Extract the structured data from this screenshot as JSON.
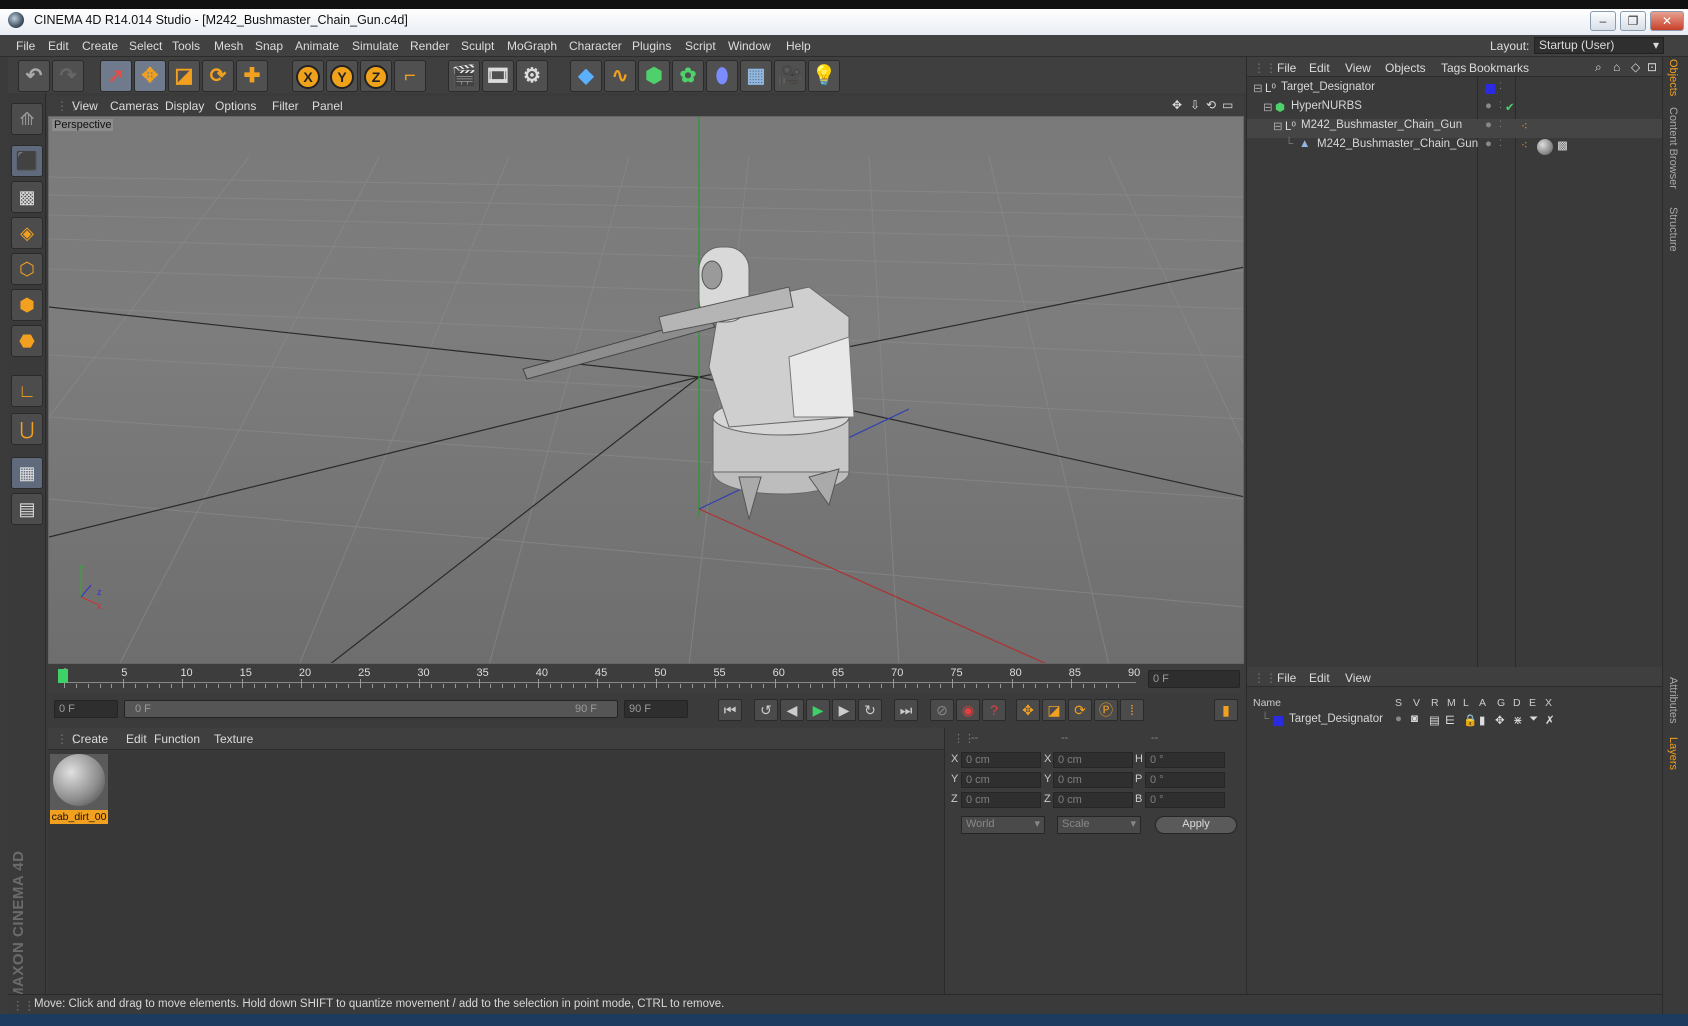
{
  "window": {
    "title": "CINEMA 4D R14.014 Studio - [M242_Bushmaster_Chain_Gun.c4d]",
    "layout_label": "Layout:",
    "layout_value": "Startup (User)"
  },
  "menubar": [
    "File",
    "Edit",
    "Create",
    "Select",
    "Tools",
    "Mesh",
    "Snap",
    "Animate",
    "Simulate",
    "Render",
    "Sculpt",
    "MoGraph",
    "Character",
    "Plugins",
    "Script",
    "Window",
    "Help"
  ],
  "viewport": {
    "menu": [
      "View",
      "Cameras",
      "Display",
      "Options",
      "Filter",
      "Panel"
    ],
    "label": "Perspective"
  },
  "timeline": {
    "ticks": [
      "0",
      "5",
      "10",
      "15",
      "20",
      "25",
      "30",
      "35",
      "40",
      "45",
      "50",
      "55",
      "60",
      "65",
      "70",
      "75",
      "80",
      "85",
      "90"
    ],
    "current_frame": "0 F"
  },
  "transport": {
    "start": "0 F",
    "range_start": "0 F",
    "range_end": "90 F",
    "end": "90 F"
  },
  "material_manager": {
    "menu": [
      "Create",
      "Edit",
      "Function",
      "Texture"
    ],
    "materials": [
      {
        "name": "cab_dirt_00"
      }
    ]
  },
  "coordinates": {
    "header": [
      "--",
      "--",
      "--"
    ],
    "rows": [
      {
        "a": "X",
        "av": "0 cm",
        "b": "X",
        "bv": "0 cm",
        "c": "H",
        "cv": "0 °"
      },
      {
        "a": "Y",
        "av": "0 cm",
        "b": "Y",
        "bv": "0 cm",
        "c": "P",
        "cv": "0 °"
      },
      {
        "a": "Z",
        "av": "0 cm",
        "b": "Z",
        "bv": "0 cm",
        "c": "B",
        "cv": "0 °"
      }
    ],
    "mode": "World",
    "scale": "Scale",
    "apply": "Apply"
  },
  "object_manager": {
    "menu": [
      "File",
      "Edit",
      "View",
      "Objects",
      "Tags",
      "Bookmarks"
    ],
    "objects": [
      {
        "name": "Target_Designator"
      },
      {
        "name": "HyperNURBS"
      },
      {
        "name": "M242_Bushmaster_Chain_Gun"
      },
      {
        "name": "M242_Bushmaster_Chain_Gun"
      }
    ]
  },
  "layer_manager": {
    "menu": [
      "File",
      "Edit",
      "View"
    ],
    "columns": [
      "Name",
      "S",
      "V",
      "R",
      "M",
      "L",
      "A",
      "G",
      "D",
      "E",
      "X"
    ],
    "layers": [
      {
        "name": "Target_Designator"
      }
    ]
  },
  "right_tabs": [
    "Objects",
    "Content Browser",
    "Structure",
    "Attributes",
    "Layers"
  ],
  "branding": "MAXON CINEMA 4D",
  "status": "Move: Click and drag to move elements. Hold down SHIFT to quantize movement / add to the selection in point mode, CTRL to remove.",
  "colors": {
    "accent": "#f2a01f",
    "layer_blue": "#2a2ae0",
    "selection": "#f2a01f"
  }
}
